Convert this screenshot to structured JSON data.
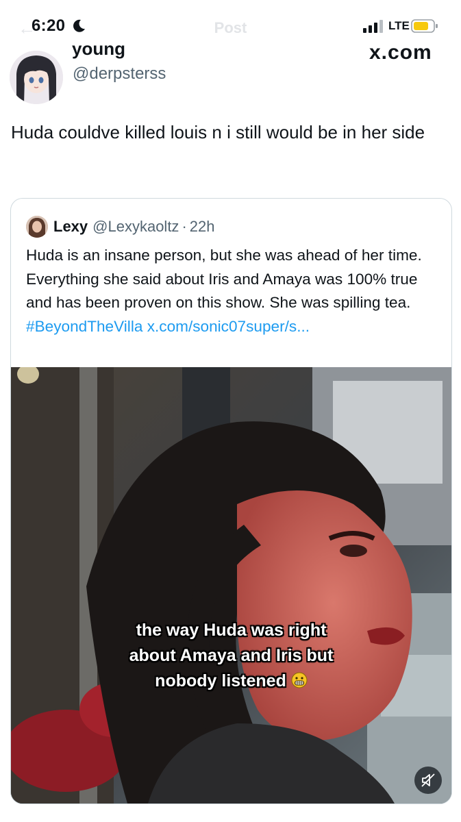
{
  "status_bar": {
    "time": "6:20",
    "network": "LTE",
    "icons": [
      "moon-icon",
      "signal-icon",
      "battery-icon"
    ]
  },
  "header": {
    "title": "Post",
    "back_icon": "arrow-left-icon"
  },
  "tweet": {
    "display_name": "young",
    "handle": "@derpsterss",
    "source": "x.com",
    "text": "Huda couldve killed louis n i still would be in her side"
  },
  "quoted_tweet": {
    "author_name": "Lexy",
    "handle": "@Lexykaoltz",
    "separator": "·",
    "time": "22h",
    "text": "Huda is an insane person, but she was ahead of her time. Everything she said about Iris and Amaya was 100% true and has been proven on this show. She was spilling tea.",
    "hashtag": "#BeyondTheVilla",
    "link": "x.com/sonic07super/s...",
    "video": {
      "caption_lines": [
        "the way Huda was right",
        "about Amaya and Iris but",
        "nobody listened"
      ],
      "caption_emoji": "grimacing-face-emoji",
      "muted": true,
      "mute_icon": "speaker-muted-icon"
    }
  },
  "colors": {
    "text": "#0f1419",
    "secondary": "#536471",
    "link": "#1d9bf0",
    "border": "#cfd9de",
    "battery": "#f6c90e"
  }
}
